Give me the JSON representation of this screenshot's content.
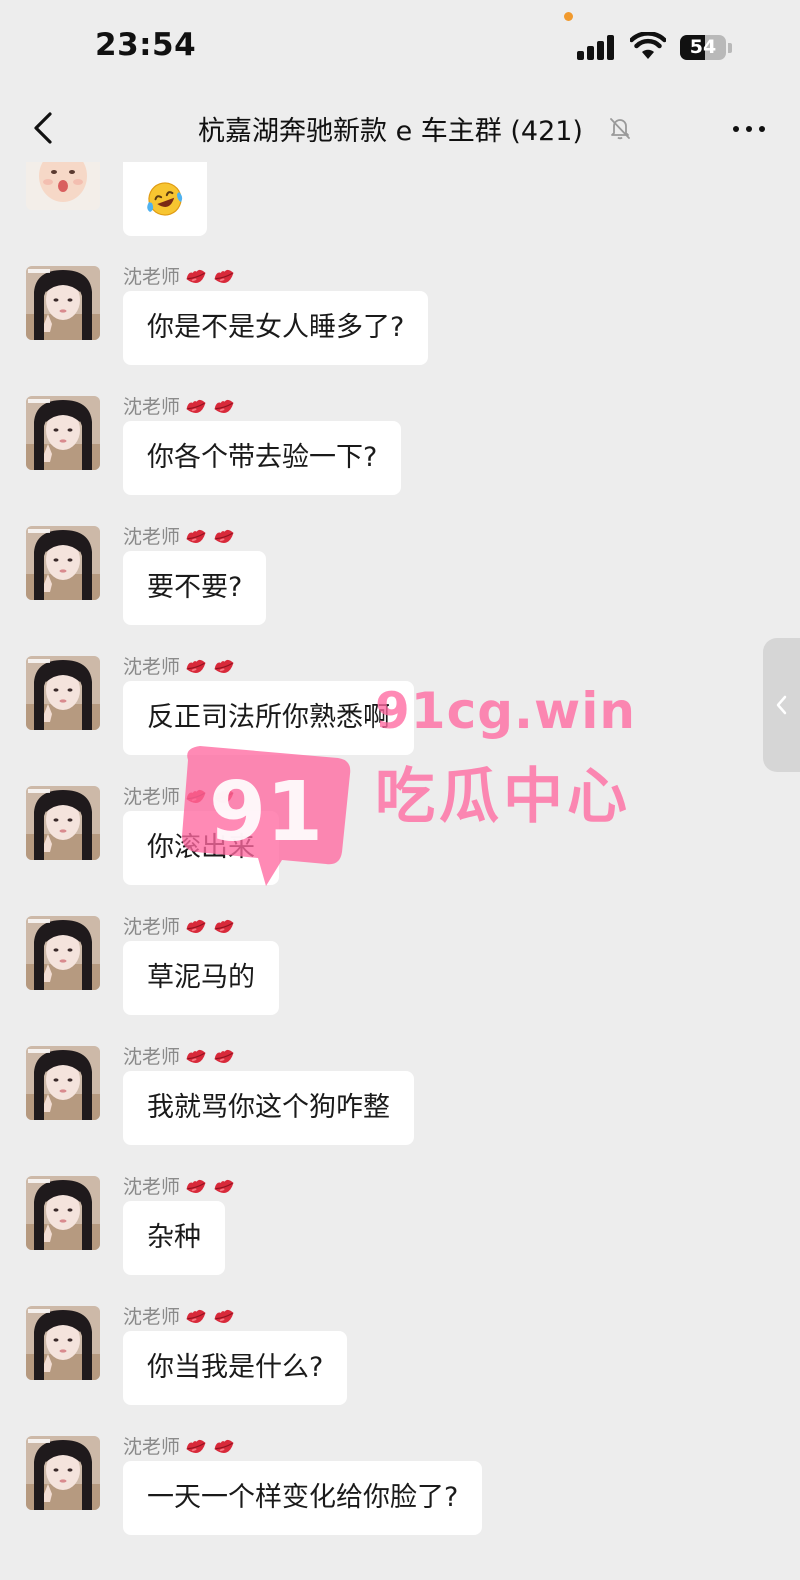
{
  "status_bar": {
    "time": "23:54",
    "battery": "54"
  },
  "header": {
    "title": "杭嘉湖奔驰新款 e 车主群 (421)"
  },
  "messages": [
    {
      "sender": "",
      "text": ""
    },
    {
      "sender": "沈老师",
      "text": "你是不是女人睡多了?"
    },
    {
      "sender": "沈老师",
      "text": "你各个带去验一下?"
    },
    {
      "sender": "沈老师",
      "text": "要不要?"
    },
    {
      "sender": "沈老师",
      "text": "反正司法所你熟悉啊"
    },
    {
      "sender": "沈老师",
      "text": "你滚出来"
    },
    {
      "sender": "沈老师",
      "text": "草泥马的"
    },
    {
      "sender": "沈老师",
      "text": "我就骂你这个狗咋整"
    },
    {
      "sender": "沈老师",
      "text": "杂种"
    },
    {
      "sender": "沈老师",
      "text": "你当我是什么?"
    },
    {
      "sender": "沈老师",
      "text": "一天一个样变化给你脸了?"
    }
  ],
  "watermark": {
    "logo": "91",
    "url": "91cg.win",
    "name": "吃瓜中心"
  },
  "icons": {
    "back": "chevron-left-icon",
    "mute": "bell-slash-icon",
    "more": "more-dots-icon",
    "badge": "lips-icon",
    "emoji": "laughing-crying-emoji-icon",
    "side_handle": "chevron-left-icon"
  },
  "colors": {
    "background": "#ededed",
    "bubble": "#ffffff",
    "sender": "#8a8a8a",
    "badge": "#d8293a",
    "watermark": "#ff69a0"
  }
}
